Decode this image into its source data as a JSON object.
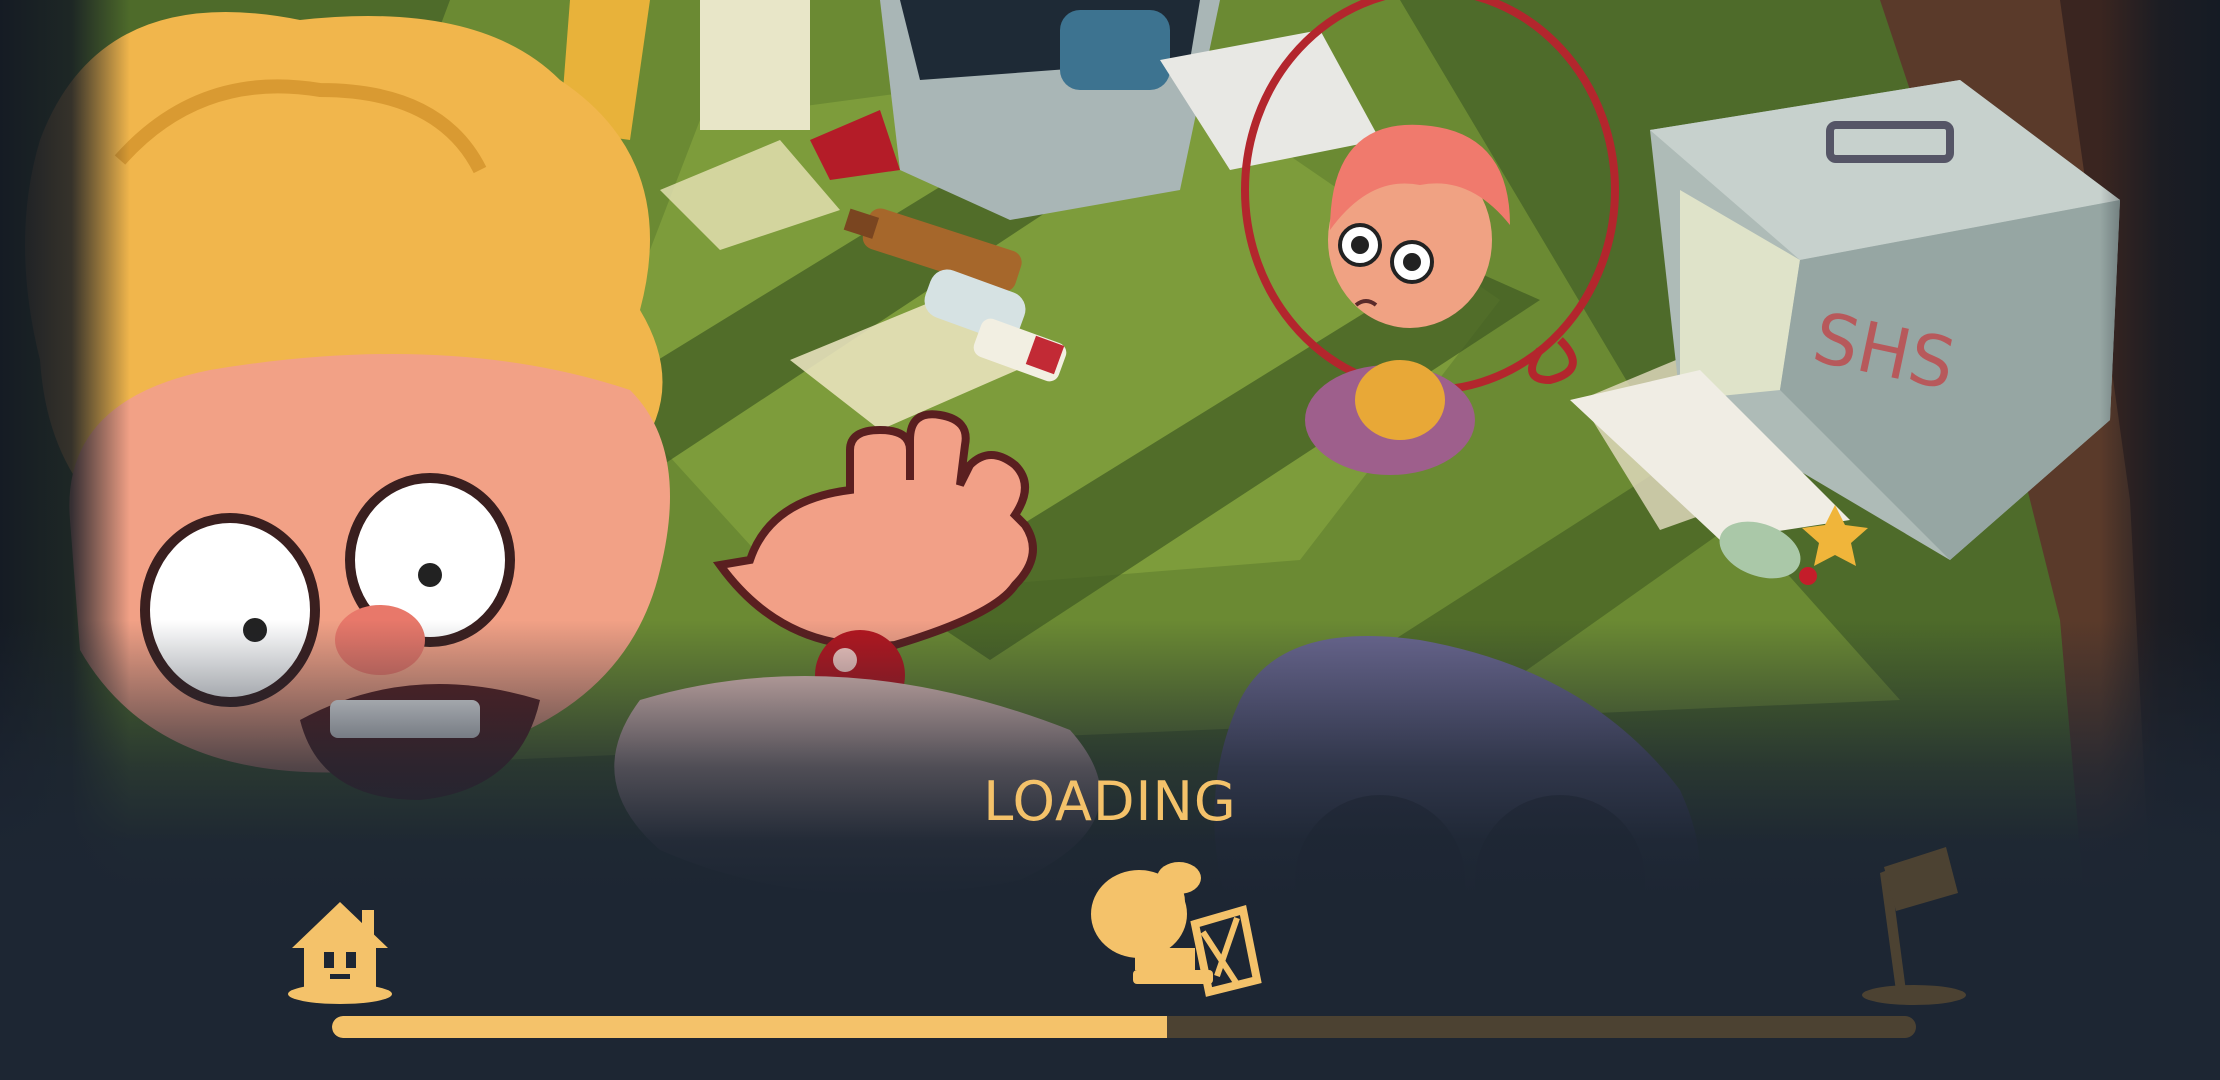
{
  "loading": {
    "label": "LOADING",
    "progress_percent": 52.7
  },
  "icons": {
    "start": "house-with-face-icon",
    "runner": "running-character-with-trolley-icon",
    "finish": "goal-flag-icon"
  },
  "colors": {
    "accent": "#f4c26a",
    "track": "#4c4232",
    "background": "#1d2633"
  },
  "scene": {
    "graffiti_text": "SHS"
  }
}
